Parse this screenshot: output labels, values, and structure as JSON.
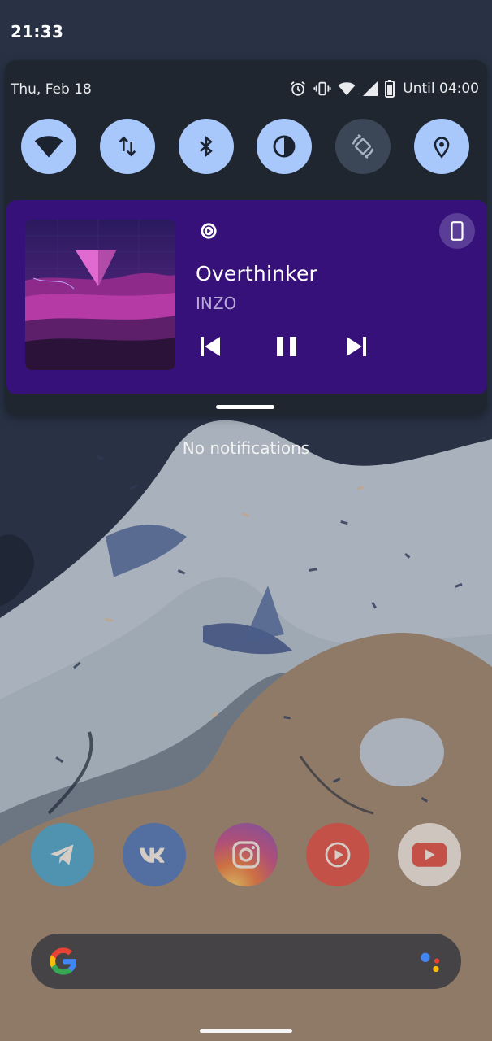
{
  "status_bar": {
    "time": "21:33"
  },
  "quick_settings": {
    "date": "Thu, Feb 18",
    "battery_text": "Until 04:00",
    "tiles": [
      {
        "name": "wifi",
        "icon": "wifi-icon",
        "active": true
      },
      {
        "name": "mobile-data",
        "icon": "data-arrows-icon",
        "active": true
      },
      {
        "name": "bluetooth",
        "icon": "bluetooth-icon",
        "active": true
      },
      {
        "name": "dark-theme",
        "icon": "contrast-icon",
        "active": true
      },
      {
        "name": "auto-rotate",
        "icon": "rotate-icon",
        "active": false
      },
      {
        "name": "location",
        "icon": "location-pin-icon",
        "active": true
      }
    ]
  },
  "media": {
    "title": "Overthinker",
    "artist": "INZO",
    "app_icon": "youtube-music-icon",
    "output_icon": "phone-icon",
    "controls": [
      "skip-previous-icon",
      "pause-icon",
      "skip-next-icon"
    ],
    "card_color": "#37117a"
  },
  "notifications": {
    "empty_text": "No notifications"
  },
  "dock": {
    "apps": [
      {
        "name": "telegram",
        "icon": "telegram-icon",
        "color": "#2aa3df"
      },
      {
        "name": "vk",
        "icon": "vk-icon",
        "color": "#2f68c4"
      },
      {
        "name": "instagram",
        "icon": "instagram-icon",
        "color": "#c13584"
      },
      {
        "name": "youtube-music",
        "icon": "youtube-music-icon",
        "color": "#e53935"
      },
      {
        "name": "youtube",
        "icon": "youtube-icon",
        "color": "#e53935"
      }
    ]
  },
  "search": {
    "logo": "google-g-icon",
    "assistant": "assistant-dots-icon"
  }
}
